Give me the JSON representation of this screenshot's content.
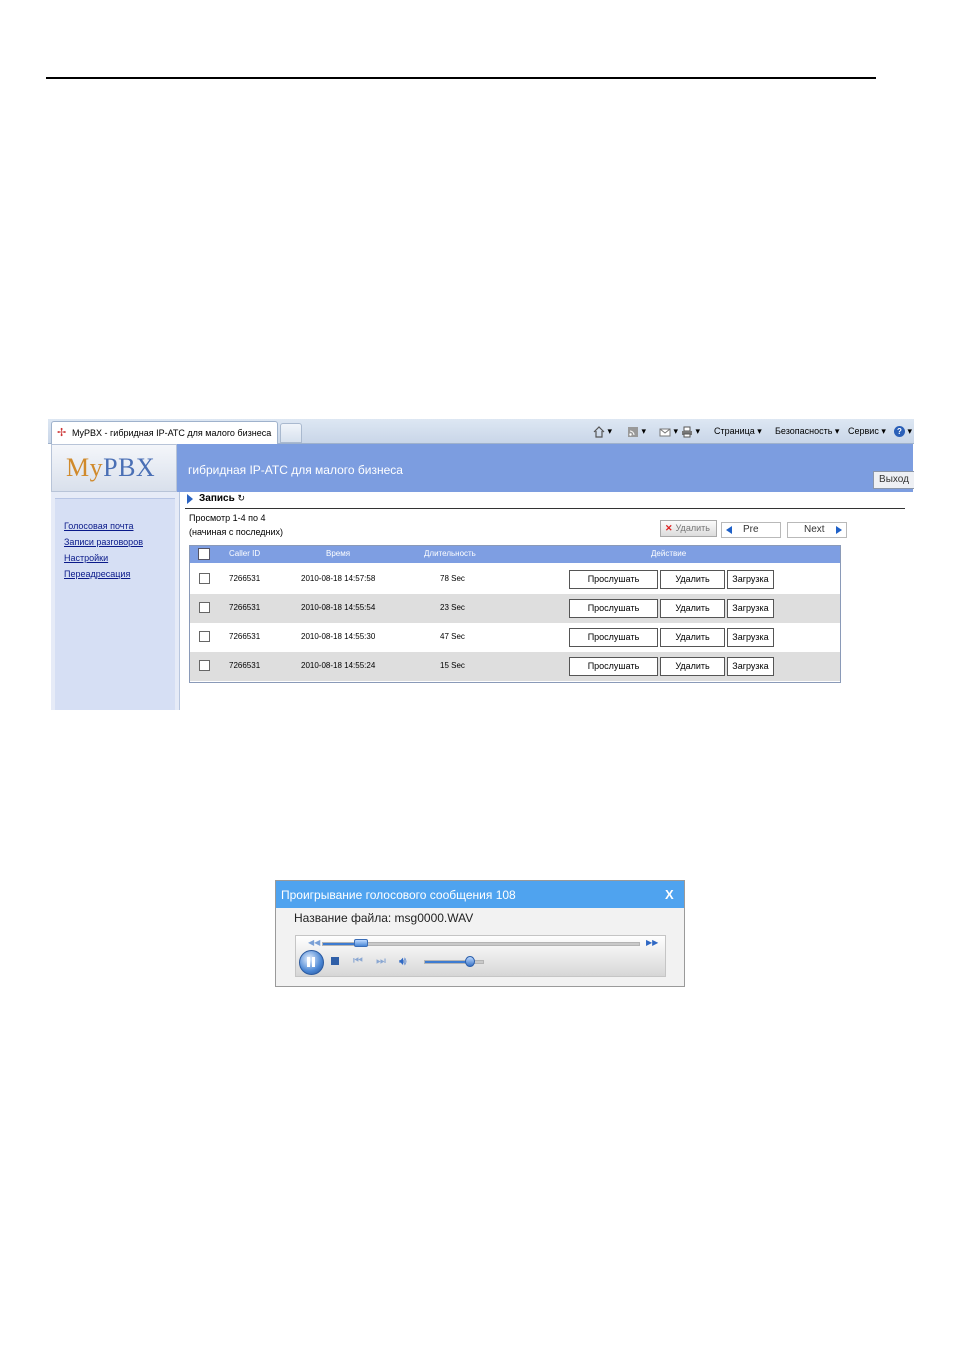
{
  "browser": {
    "tab_title": "MyPBX - гибридная IP-АТС для малого бизнеса",
    "toolbar": {
      "page_menu": "Страница",
      "safety_menu": "Безопасность",
      "tools_menu": "Сервис",
      "help_label": "?"
    }
  },
  "app": {
    "logo": "MyPBX",
    "title": "гибридная IP-АТС для малого бизнеса",
    "logout": "Выход"
  },
  "sidebar": {
    "items": [
      {
        "label": "Голосовая почта"
      },
      {
        "label": "Записи разговоров"
      },
      {
        "label": "Настройки"
      },
      {
        "label": "Переадресация"
      }
    ]
  },
  "main": {
    "section_title": "Запись",
    "view_range": "Просмотр 1-4 по 4",
    "view_order": "(начиная с последних)",
    "delete_button": "Удалить",
    "pre_button": "Pre",
    "next_button": "Next"
  },
  "table": {
    "headers": {
      "caller_id": "Caller ID",
      "time": "Время",
      "duration": "Длительность",
      "action": "Действие"
    },
    "rows": [
      {
        "caller_id": "7266531",
        "time": "2010-08-18 14:57:58",
        "duration": "78 Sec"
      },
      {
        "caller_id": "7266531",
        "time": "2010-08-18 14:55:54",
        "duration": "23 Sec"
      },
      {
        "caller_id": "7266531",
        "time": "2010-08-18 14:55:30",
        "duration": "47 Sec"
      },
      {
        "caller_id": "7266531",
        "time": "2010-08-18 14:55:24",
        "duration": "15 Sec"
      }
    ],
    "actions": {
      "play": "Прослушать",
      "delete": "Удалить",
      "download": "Загрузка"
    }
  },
  "player": {
    "title": "Проигрывание голосового сообщения 108",
    "close": "X",
    "file_label": "Название файла: msg0000.WAV",
    "seek_progress": 0.12,
    "volume_level": 0.75
  },
  "colors": {
    "header_blue": "#7c9de0",
    "dialog_title": "#4fa3ef",
    "logo_orange": "#d08a2c"
  }
}
